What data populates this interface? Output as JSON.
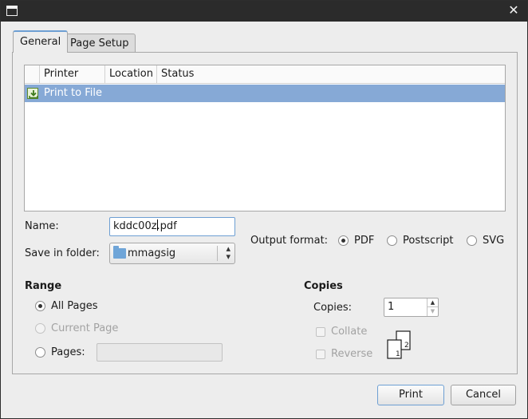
{
  "window": {
    "close_glyph": "✕"
  },
  "tabs": [
    {
      "label": "General",
      "active": true
    },
    {
      "label": "Page Setup",
      "active": false
    }
  ],
  "printer_list": {
    "columns": [
      "Printer",
      "Location",
      "Status"
    ],
    "rows": [
      {
        "printer": "Print to File",
        "location": "",
        "status": "",
        "selected": true,
        "icon": "print-to-file-icon"
      }
    ]
  },
  "file": {
    "name_label": "Name:",
    "name_before_caret": "kddc00z",
    "name_after_caret": ".pdf",
    "folder_label": "Save in folder:",
    "folder_value": "mmagsig",
    "folder_icon": "folder-icon"
  },
  "output_format": {
    "label": "Output format:",
    "options": [
      "PDF",
      "Postscript",
      "SVG"
    ],
    "selected": "PDF"
  },
  "range": {
    "heading": "Range",
    "all_pages": "All Pages",
    "current_page": "Current Page",
    "pages": "Pages:",
    "pages_value": "",
    "selected": "All Pages"
  },
  "copies": {
    "heading": "Copies",
    "copies_label": "Copies:",
    "copies_value": "1",
    "collate_label": "Collate",
    "reverse_label": "Reverse",
    "collate_checked": false,
    "reverse_checked": false,
    "page_numbers": [
      "1",
      "2"
    ]
  },
  "buttons": {
    "print": "Print",
    "cancel": "Cancel"
  },
  "colors": {
    "accent": "#6d9fd3",
    "selection": "#86a9d6",
    "titlebar": "#2b2b2b"
  }
}
